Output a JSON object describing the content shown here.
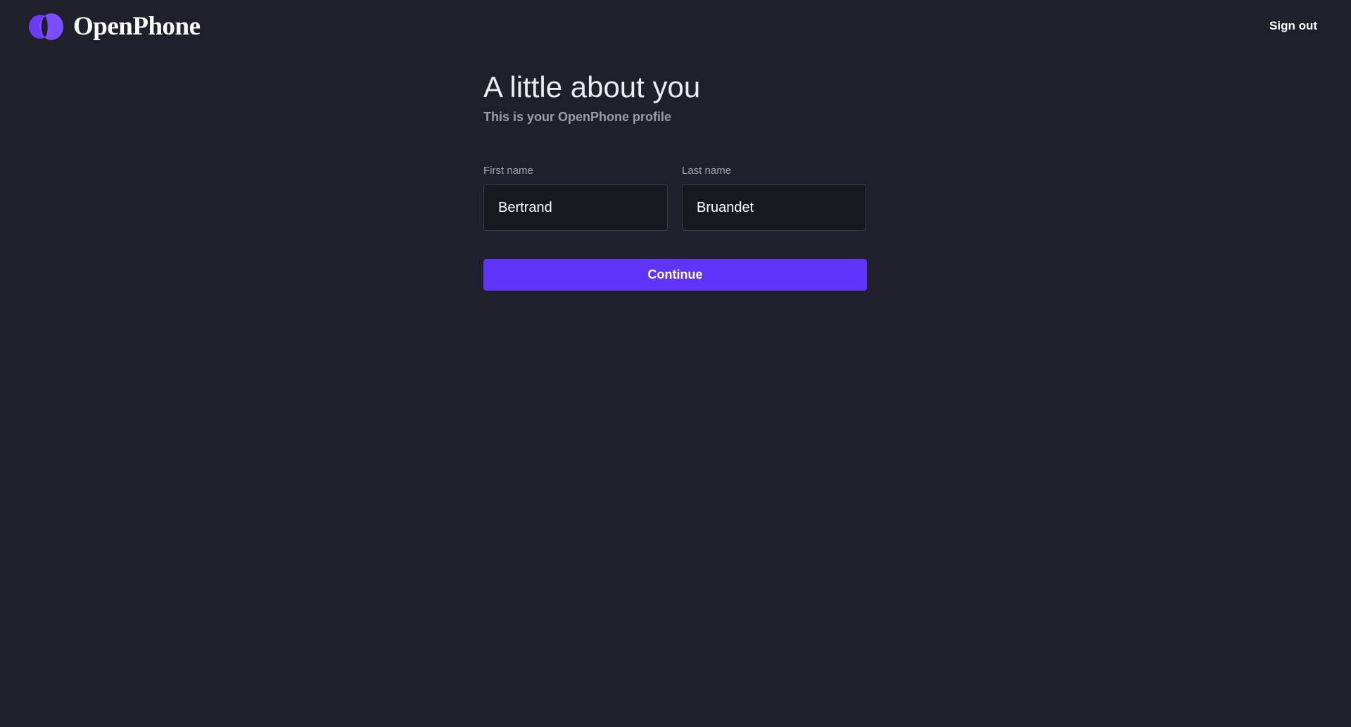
{
  "header": {
    "logo_text": "OpenPhone",
    "logo_icon": "openphone-logo-icon",
    "signout_label": "Sign out"
  },
  "main": {
    "title": "A little about you",
    "subtitle": "This is your OpenPhone profile",
    "first_name": {
      "label": "First name",
      "value": "Bertrand"
    },
    "last_name": {
      "label": "Last name",
      "value": "Bruandet"
    },
    "continue_label": "Continue"
  },
  "colors": {
    "background": "#1f202c",
    "accent": "#6034fb",
    "input_background": "#181820"
  }
}
